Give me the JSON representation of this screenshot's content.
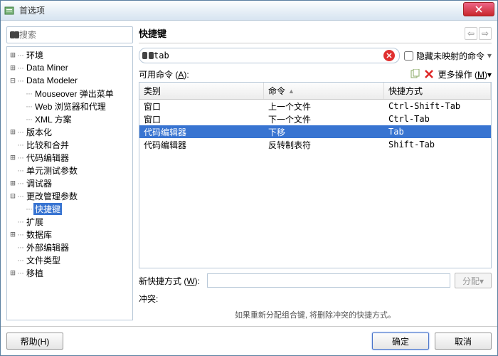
{
  "window": {
    "title": "首选项"
  },
  "search": {
    "placeholder": "搜索"
  },
  "tree": [
    {
      "label": "环境",
      "expandable": true,
      "depth": 0
    },
    {
      "label": "Data Miner",
      "expandable": true,
      "depth": 0
    },
    {
      "label": "Data Modeler",
      "expandable": true,
      "depth": 0,
      "expanded": true
    },
    {
      "label": "Mouseover 弹出菜单",
      "expandable": false,
      "depth": 1
    },
    {
      "label": "Web 浏览器和代理",
      "expandable": false,
      "depth": 1
    },
    {
      "label": "XML 方案",
      "expandable": false,
      "depth": 1
    },
    {
      "label": "版本化",
      "expandable": true,
      "depth": 0
    },
    {
      "label": "比较和合并",
      "expandable": false,
      "depth": 0
    },
    {
      "label": "代码编辑器",
      "expandable": true,
      "depth": 0
    },
    {
      "label": "单元测试参数",
      "expandable": false,
      "depth": 0
    },
    {
      "label": "调试器",
      "expandable": true,
      "depth": 0
    },
    {
      "label": "更改管理参数",
      "expandable": true,
      "depth": 0,
      "expanded": true
    },
    {
      "label": "快捷键",
      "expandable": false,
      "depth": 1,
      "selected": true
    },
    {
      "label": "扩展",
      "expandable": false,
      "depth": 0
    },
    {
      "label": "数据库",
      "expandable": true,
      "depth": 0
    },
    {
      "label": "外部编辑器",
      "expandable": false,
      "depth": 0
    },
    {
      "label": "文件类型",
      "expandable": false,
      "depth": 0
    },
    {
      "label": "移植",
      "expandable": true,
      "depth": 0
    }
  ],
  "panel": {
    "title": "快捷键",
    "filter_value": "tab",
    "hide_unmapped_label": "隐藏未映射的命令",
    "available_label_pre": "可用命令 (",
    "available_label_u": "A",
    "available_label_post": "):",
    "more_actions_pre": "更多操作 (",
    "more_actions_u": "M",
    "more_actions_post": ")",
    "columns": {
      "c1": "类别",
      "c2": "命令",
      "c3": "快捷方式"
    },
    "rows": [
      {
        "cat": "窗口",
        "cmd": "上一个文件",
        "key": "Ctrl-Shift-Tab"
      },
      {
        "cat": "窗口",
        "cmd": "下一个文件",
        "key": "Ctrl-Tab"
      },
      {
        "cat": "代码编辑器",
        "cmd": "下移",
        "key": "Tab",
        "selected": true
      },
      {
        "cat": "代码编辑器",
        "cmd": "反转制表符",
        "key": "Shift-Tab"
      }
    ],
    "new_shortcut_label_pre": "新快捷方式 (",
    "new_shortcut_label_u": "W",
    "new_shortcut_label_post": ":",
    "assign_label": "分配",
    "conflict_label": "冲突:",
    "hint": "如果重新分配组合键, 将删除冲突的快捷方式。"
  },
  "footer": {
    "help": "帮助(H)",
    "ok": "确定",
    "cancel": "取消"
  }
}
